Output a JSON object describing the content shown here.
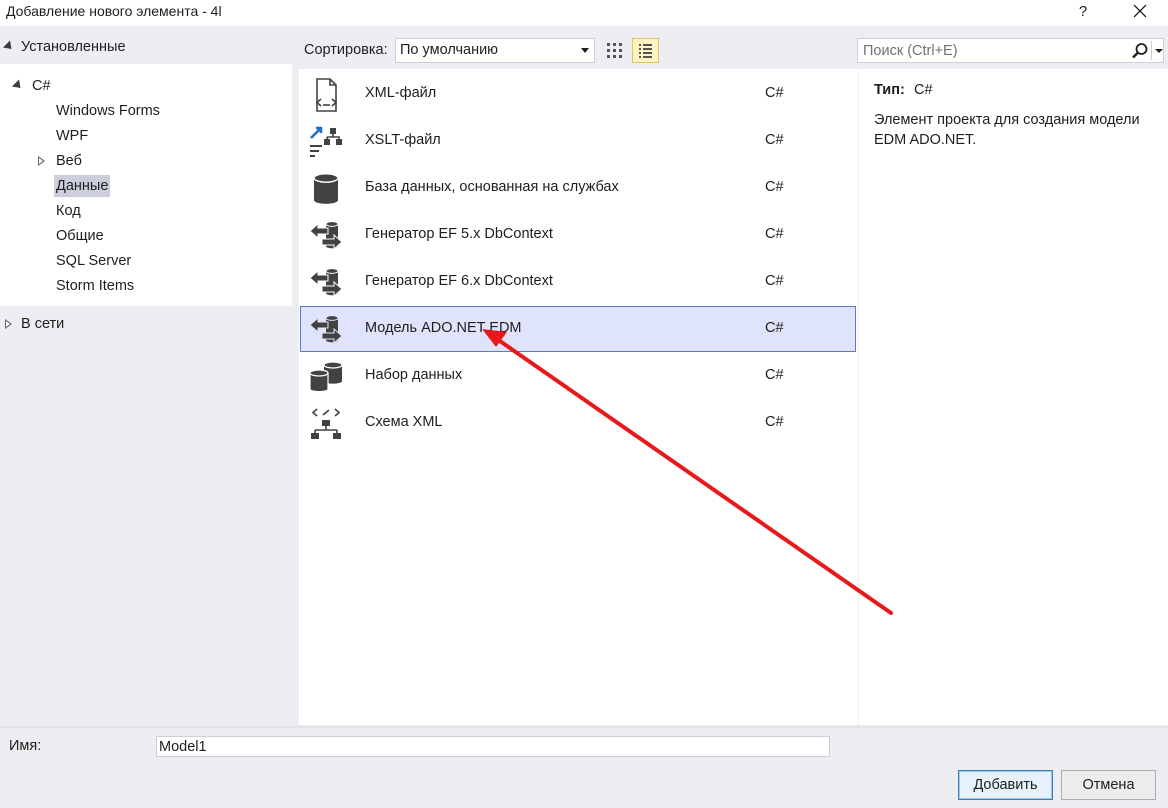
{
  "window": {
    "title": "Добавление нового элемента  - 4l",
    "help_label": "?"
  },
  "tree": {
    "installed_label": "Установленные",
    "csharp_label": "C#",
    "items": [
      "Windows Forms",
      "WPF",
      "Веб",
      "Данные",
      "Код",
      "Общие",
      "SQL Server",
      "Storm Items"
    ],
    "selected_item": "Данные",
    "online_label": "В сети"
  },
  "toolbar": {
    "sort_label": "Сортировка:",
    "sort_value": "По умолчанию",
    "search_placeholder": "Поиск (Ctrl+E)"
  },
  "templates": [
    {
      "name": "XML-файл",
      "lang": "C#",
      "icon": "xml-file-icon"
    },
    {
      "name": "XSLT-файл",
      "lang": "C#",
      "icon": "xslt-file-icon"
    },
    {
      "name": "База данных, основанная на службах",
      "lang": "C#",
      "icon": "database-icon"
    },
    {
      "name": "Генератор EF 5.x DbContext",
      "lang": "C#",
      "icon": "ef-generator-icon"
    },
    {
      "name": "Генератор EF 6.x DbContext",
      "lang": "C#",
      "icon": "ef-generator-icon"
    },
    {
      "name": "Модель ADO.NET EDM",
      "lang": "C#",
      "icon": "ado-model-icon",
      "selected": true
    },
    {
      "name": "Набор данных",
      "lang": "C#",
      "icon": "dataset-icon"
    },
    {
      "name": "Схема XML",
      "lang": "C#",
      "icon": "xml-schema-icon"
    }
  ],
  "details": {
    "type_label": "Тип:",
    "type_value": "C#",
    "description": "Элемент проекта для создания модели EDM ADO.NET."
  },
  "footer": {
    "name_label": "Имя:",
    "name_value": "Model1",
    "add_label": "Добавить",
    "cancel_label": "Отмена"
  },
  "colors": {
    "selection_bg": "#dfe3fb",
    "selection_border": "#6a75c6",
    "annotation_arrow": "#e8191b"
  }
}
